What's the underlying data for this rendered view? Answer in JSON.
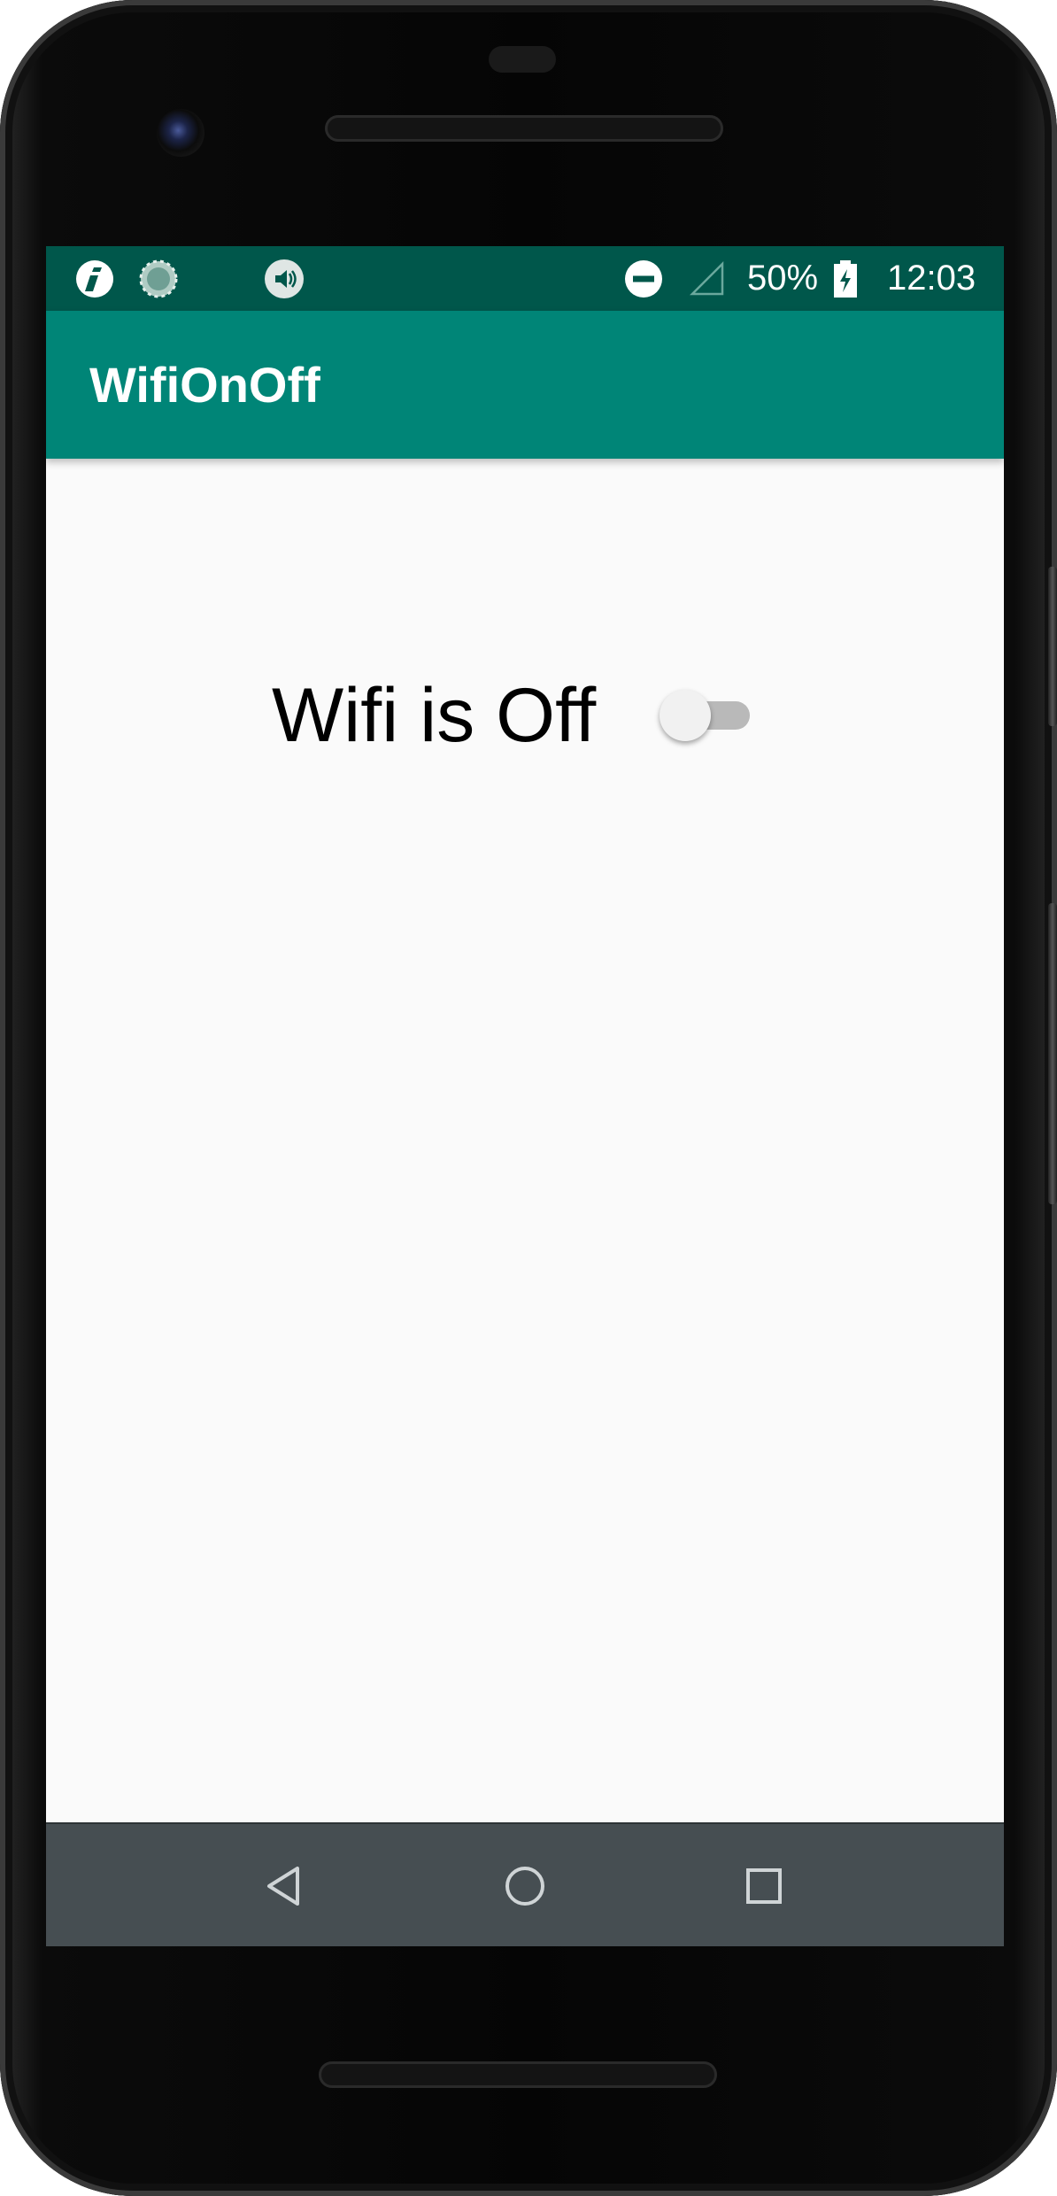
{
  "status_bar": {
    "battery_percent": "50%",
    "time": "12:03",
    "icons": [
      "info-app-icon",
      "loading-indicator-icon",
      "volume-icon",
      "do-not-disturb-icon",
      "signal-icon",
      "battery-charging-icon"
    ]
  },
  "app_bar": {
    "title": "WifiOnOff"
  },
  "main": {
    "wifi_label": "Wifi is Off",
    "wifi_switch_on": false
  },
  "nav_bar": {
    "icons": [
      "back-icon",
      "home-icon",
      "recents-icon"
    ]
  },
  "colors": {
    "status_bar": "#00574b",
    "app_bar": "#008577",
    "screen_background": "#fafafa",
    "nav_bar": "#464e52",
    "switch_track_off": "#b9b9b9",
    "switch_thumb_off": "#f1f1f1"
  }
}
